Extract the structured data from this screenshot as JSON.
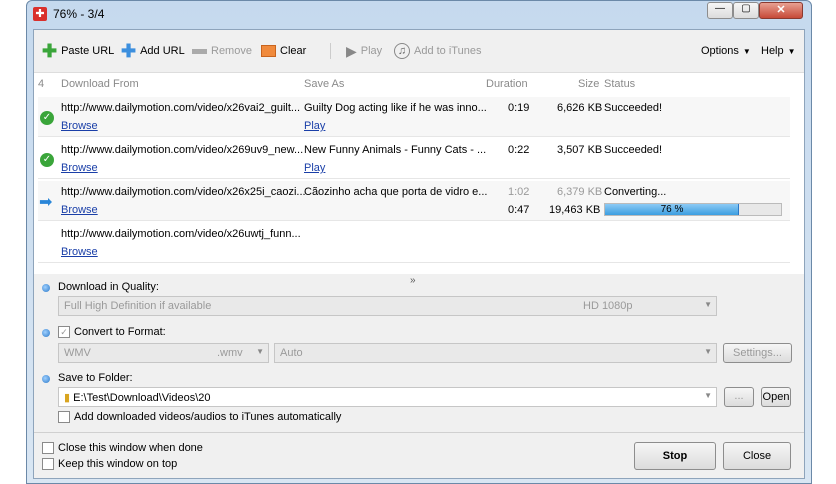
{
  "window": {
    "title": "76% - 3/4"
  },
  "toolbar": {
    "paste_url": "Paste URL",
    "add_url": "Add URL",
    "remove": "Remove",
    "clear": "Clear",
    "play": "Play",
    "add_itunes": "Add to iTunes",
    "options": "Options",
    "help": "Help"
  },
  "list": {
    "headers": {
      "count": "4",
      "from": "Download From",
      "save_as": "Save As",
      "duration": "Duration",
      "size": "Size",
      "status": "Status"
    },
    "rows": [
      {
        "url": "http://www.dailymotion.com/video/x26vai2_guilt...",
        "browse": "Browse",
        "save_as": "Guilty Dog acting like if he was inno...",
        "play": "Play",
        "duration": "0:19",
        "size": "6,626 KB",
        "status": "Succeeded!"
      },
      {
        "url": "http://www.dailymotion.com/video/x269uv9_new...",
        "browse": "Browse",
        "save_as": "New Funny Animals - Funny Cats - ...",
        "play": "Play",
        "duration": "0:22",
        "size": "3,507 KB",
        "status": "Succeeded!"
      },
      {
        "url": "http://www.dailymotion.com/video/x26x25i_caozi...",
        "browse": "Browse",
        "save_as": "Cãozinho acha que porta de vidro e...",
        "duration": "1:02",
        "size": "6,379 KB",
        "status": "Converting...",
        "duration2": "0:47",
        "size2": "19,463 KB",
        "progress_label": "76 %",
        "progress": 76
      },
      {
        "url": "http://www.dailymotion.com/video/x26uwtj_funn...",
        "browse": "Browse"
      }
    ]
  },
  "options": {
    "quality_label": "Download in Quality:",
    "quality_value": "Full High Definition if available",
    "quality_res": "HD 1080p",
    "convert_label": "Convert to Format:",
    "format": "WMV",
    "format_ext": ".wmv",
    "format_preset": "Auto",
    "settings": "Settings...",
    "folder_label": "Save to Folder:",
    "folder": "E:\\Test\\Download\\Videos\\20",
    "browse_btn": "...",
    "open": "Open",
    "itunes_auto": "Add downloaded videos/audios to iTunes automatically"
  },
  "footer": {
    "close_when_done": "Close this window when done",
    "keep_on_top": "Keep this window on top",
    "stop": "Stop",
    "close": "Close"
  },
  "colors": {
    "accent": "#3c8fde",
    "success": "#3aa53a"
  }
}
